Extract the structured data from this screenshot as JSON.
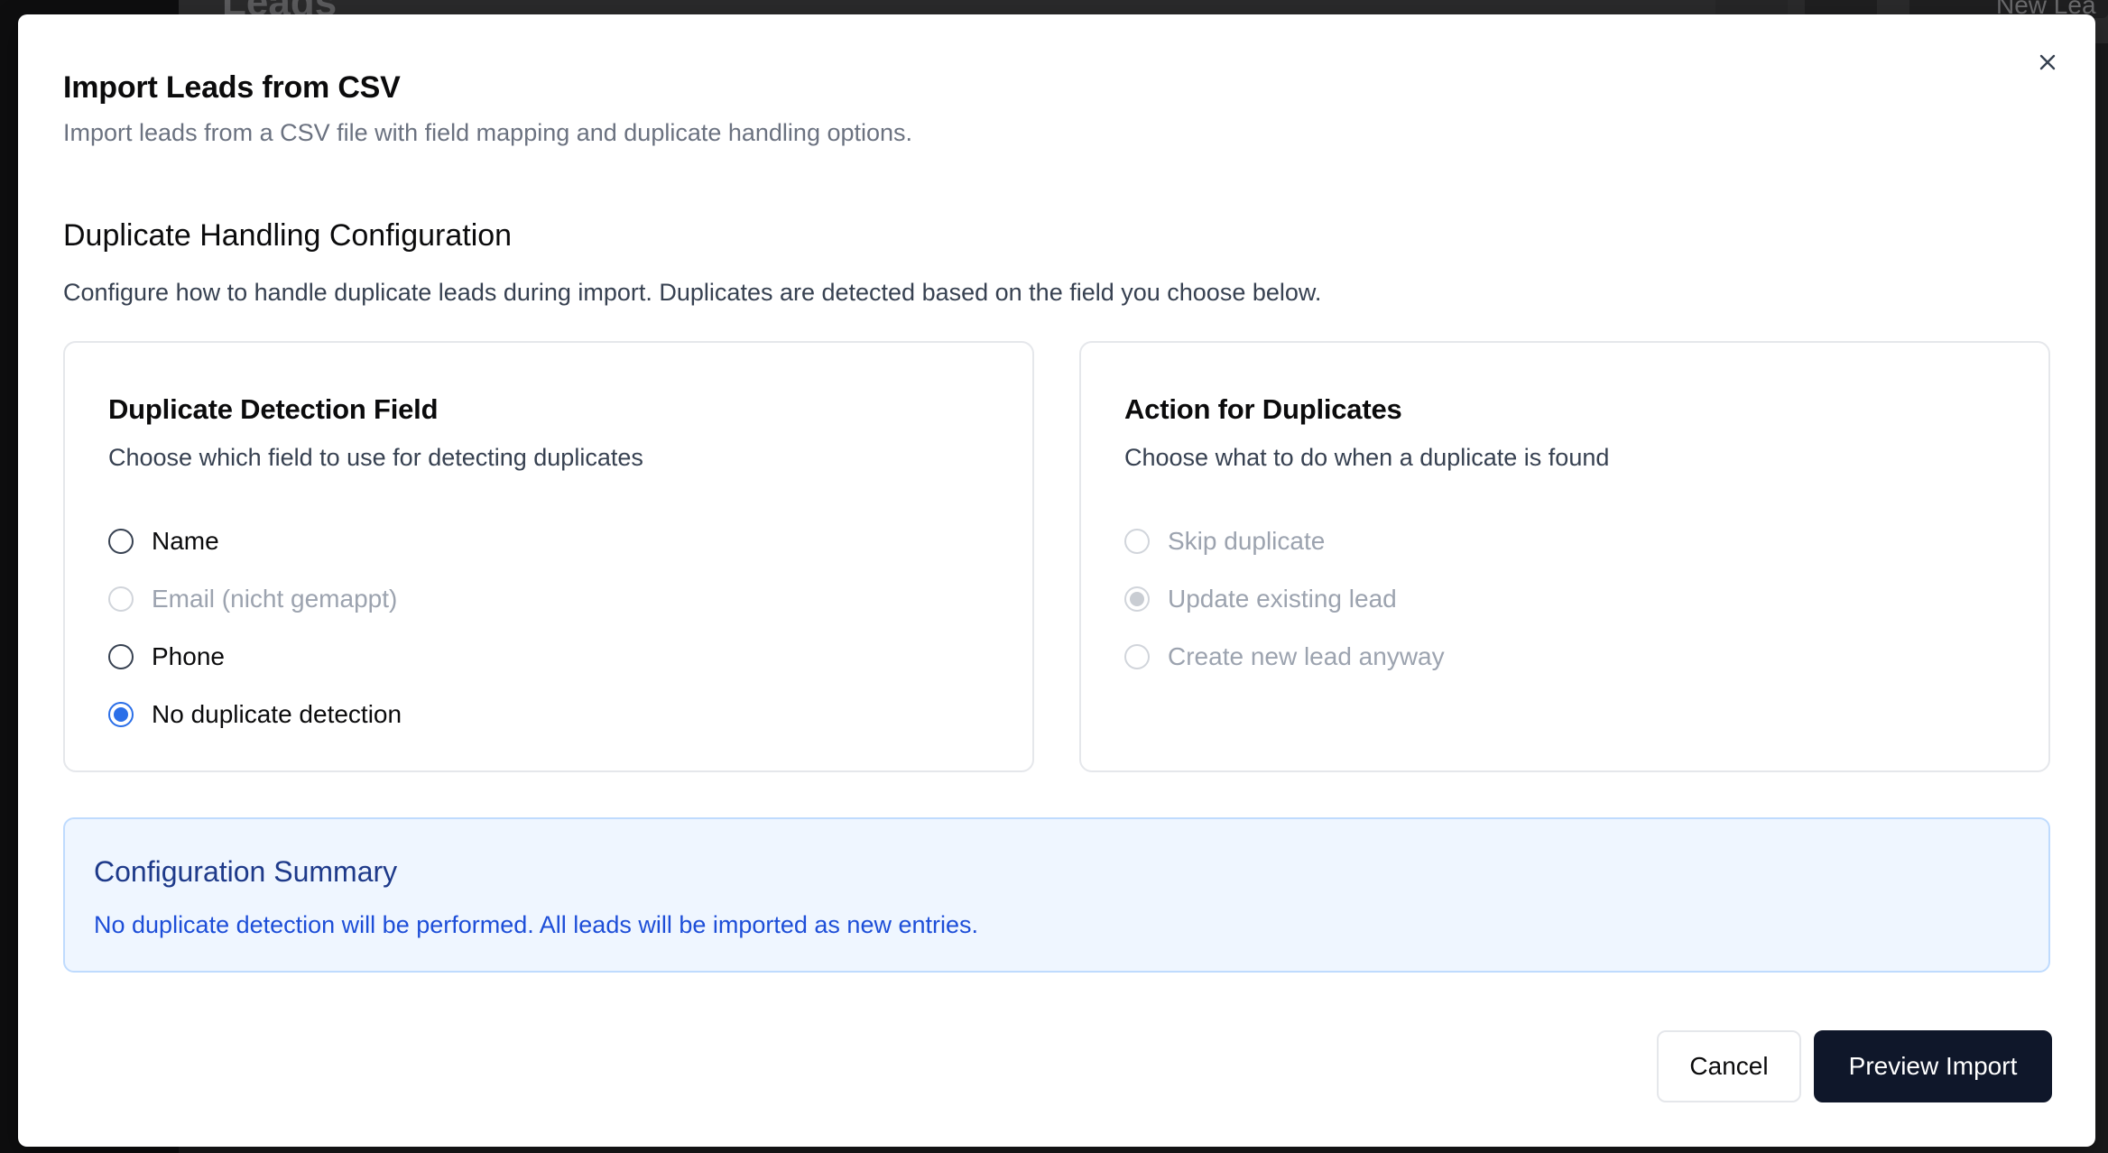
{
  "background": {
    "page_title": "Leads",
    "new_button_label": "New Lea"
  },
  "modal": {
    "title": "Import Leads from CSV",
    "subtitle": "Import leads from a CSV file with field mapping and duplicate handling options."
  },
  "section": {
    "title": "Duplicate Handling Configuration",
    "description": "Configure how to handle duplicate leads during import. Duplicates are detected based on the field you choose below."
  },
  "detection": {
    "title": "Duplicate Detection Field",
    "description": "Choose which field to use for detecting duplicates",
    "options": [
      {
        "label": "Name",
        "checked": false,
        "disabled": false
      },
      {
        "label": "Email (nicht gemappt)",
        "checked": false,
        "disabled": true
      },
      {
        "label": "Phone",
        "checked": false,
        "disabled": false
      },
      {
        "label": "No duplicate detection",
        "checked": true,
        "disabled": false
      }
    ]
  },
  "action": {
    "title": "Action for Duplicates",
    "description": "Choose what to do when a duplicate is found",
    "options": [
      {
        "label": "Skip duplicate",
        "checked": false,
        "disabled": true
      },
      {
        "label": "Update existing lead",
        "checked": true,
        "disabled": true
      },
      {
        "label": "Create new lead anyway",
        "checked": false,
        "disabled": true
      }
    ]
  },
  "summary": {
    "title": "Configuration Summary",
    "text": "No duplicate detection will be performed. All leads will be imported as new entries."
  },
  "buttons": {
    "cancel": "Cancel",
    "preview": "Preview Import"
  },
  "colors": {
    "accent": "#2b6fe8",
    "primary_button": "#0f172a",
    "summary_bg": "#eff6ff",
    "summary_text": "#1d4ed8"
  }
}
